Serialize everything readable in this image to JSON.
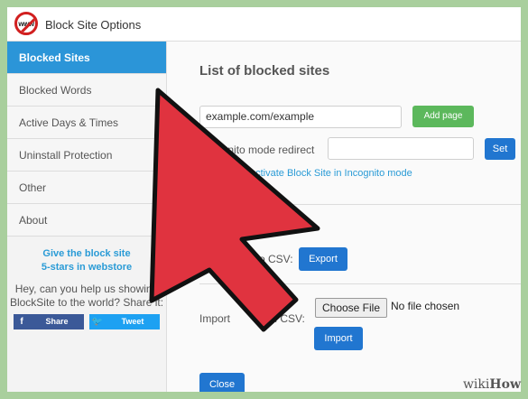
{
  "window": {
    "title": "Block Site Options",
    "logo_text": "www"
  },
  "sidebar": {
    "items": [
      {
        "label": "Blocked Sites",
        "active": true
      },
      {
        "label": "Blocked Words",
        "active": false
      },
      {
        "label": "Active Days & Times",
        "active": false
      },
      {
        "label": "Uninstall Protection",
        "active": false
      },
      {
        "label": "Other",
        "active": false
      },
      {
        "label": "About",
        "active": false
      }
    ],
    "promo_line1": "Give the block site",
    "promo_line2": "5-stars in webstore",
    "share_line1": "Hey, can you help us showing",
    "share_line2": "BlockSite to the world? Share it:",
    "facebook_label": "Share",
    "twitter_label": "Tweet"
  },
  "main": {
    "heading": "List of blocked sites",
    "site_input_value": "example.com/example",
    "add_page_label": "Add page",
    "incognito_label": "cognito mode redirect",
    "incognito_input_value": "",
    "set_label": "Set",
    "activate_link": "activate Block Site in Incognito mode",
    "export_label_left": "E",
    "export_label_right": "o CSV:",
    "export_button": "Export",
    "import_label_left": "Import",
    "import_label_right": "m CSV:",
    "choose_file_label": "Choose File",
    "no_file_text": "No file chosen",
    "import_button": "Import",
    "close_button": "Close"
  },
  "watermark": {
    "wiki": "wiki",
    "how": "How"
  },
  "colors": {
    "accent": "#2b95d8",
    "arrow": "#e0333f",
    "green": "#5cb85c",
    "button_blue": "#2176d0"
  }
}
